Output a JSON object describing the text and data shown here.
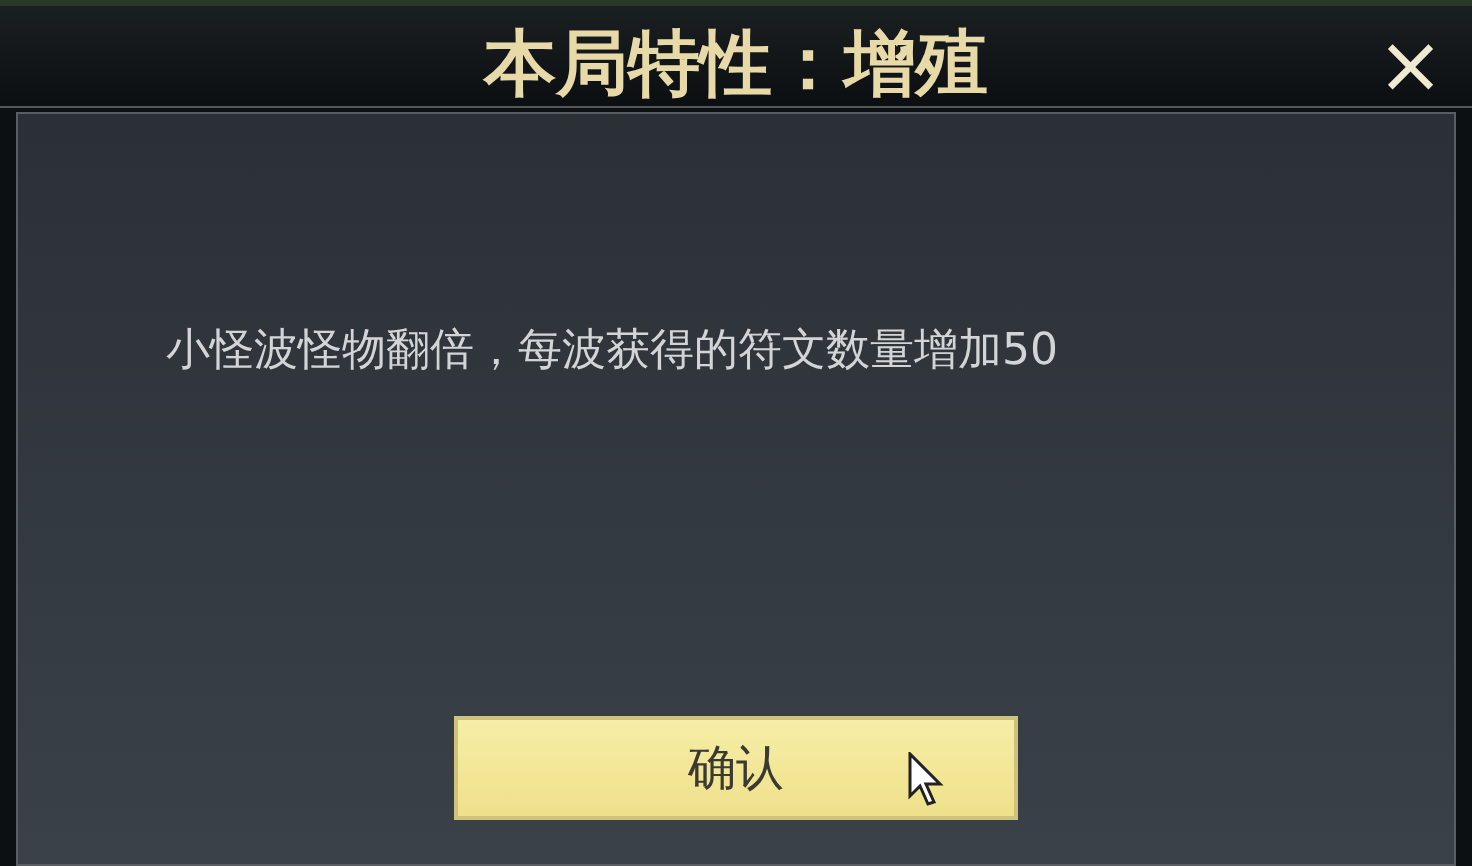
{
  "dialog": {
    "title": "本局特性：增殖",
    "close": "×",
    "message": "小怪波怪物翻倍，每波获得的符文数量增加50",
    "button": "确认"
  }
}
